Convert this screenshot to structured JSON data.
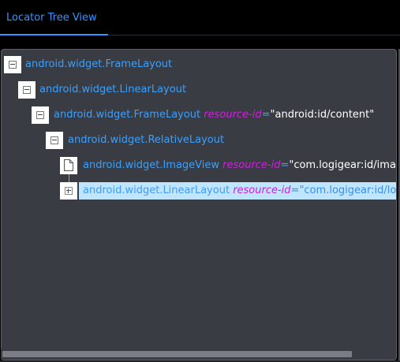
{
  "tab": {
    "label": "Locator Tree View"
  },
  "tree": {
    "nodes": [
      {
        "tag": "android.widget.FrameLayout",
        "attr_name": "",
        "attr_eq": "",
        "attr_value": "",
        "icon": "collapse-icon"
      },
      {
        "tag": "android.widget.LinearLayout",
        "attr_name": "",
        "attr_eq": "",
        "attr_value": "",
        "icon": "collapse-icon"
      },
      {
        "tag": "android.widget.FrameLayout",
        "attr_name": "resource-id",
        "attr_eq": "=",
        "attr_value": "\"android:id/content\"",
        "icon": "collapse-icon"
      },
      {
        "tag": "android.widget.RelativeLayout",
        "attr_name": "",
        "attr_eq": "",
        "attr_value": "",
        "icon": "collapse-icon"
      },
      {
        "tag": "android.widget.ImageView",
        "attr_name": "resource-id",
        "attr_eq": "=",
        "attr_value": "\"com.logigear:id/imageV",
        "icon": "file-icon"
      },
      {
        "tag": "android.widget.LinearLayout",
        "attr_name": "resource-id",
        "attr_eq": "=",
        "attr_value": "\"com.logigear:id/login(",
        "icon": "expand-icon",
        "selected": true
      }
    ]
  },
  "colors": {
    "accent": "#3794ff",
    "panel_bg": "#393c43",
    "selected_bg": "#bfe5ff",
    "attr_name": "#d21ce0"
  }
}
